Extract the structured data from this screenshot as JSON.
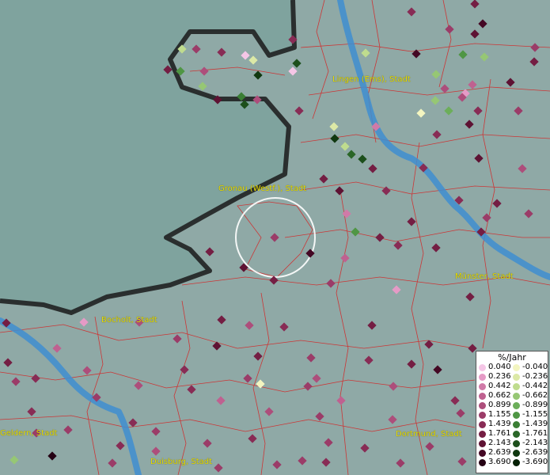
{
  "cities": [
    {
      "name": "Lingen (Ems), Stadt"
    },
    {
      "name": "Gronau (Westf.), Stadt"
    },
    {
      "name": "Bocholt, Stadt"
    },
    {
      "name": "Münster, Stadt"
    },
    {
      "name": "Geldern, Stadt"
    },
    {
      "name": "Dortmund, Stadt"
    },
    {
      "name": "Duisburg, Stadt"
    }
  ],
  "legend": {
    "title": "%/Jahr",
    "positive": [
      {
        "label": "0.040",
        "color": "#f5c6e6"
      },
      {
        "label": "0.236",
        "color": "#e59ac6"
      },
      {
        "label": "0.442",
        "color": "#d07aa8"
      },
      {
        "label": "0.662",
        "color": "#bf6190"
      },
      {
        "label": "0.899",
        "color": "#ad4e7b"
      },
      {
        "label": "1.155",
        "color": "#9b3c68"
      },
      {
        "label": "1.439",
        "color": "#882c55"
      },
      {
        "label": "1.761",
        "color": "#741e43"
      },
      {
        "label": "2.143",
        "color": "#5e1233"
      },
      {
        "label": "2.639",
        "color": "#440824"
      },
      {
        "label": "3.690",
        "color": "#250214"
      }
    ],
    "negative": [
      {
        "label": "-0.040",
        "color": "#f3f5c0"
      },
      {
        "label": "-0.236",
        "color": "#dce9a6"
      },
      {
        "label": "-0.442",
        "color": "#bfdc8e"
      },
      {
        "label": "-0.662",
        "color": "#96c774"
      },
      {
        "label": "-0.899",
        "color": "#6cae5a"
      },
      {
        "label": "-1.155",
        "color": "#4f9644"
      },
      {
        "label": "-1.439",
        "color": "#3a7e34"
      },
      {
        "label": "-1.761",
        "color": "#2a6627"
      },
      {
        "label": "-2.143",
        "color": "#1c4f1b"
      },
      {
        "label": "-2.639",
        "color": "#103810"
      },
      {
        "label": "-3.690",
        "color": "#041f05"
      }
    ]
  },
  "colors": {
    "background": "#8fa9a6",
    "sea": "#7fa39e",
    "boundary": "#d22a2a",
    "river": "#3f8ed0",
    "border": "#1a1a1a",
    "label": "#e8e000"
  }
}
